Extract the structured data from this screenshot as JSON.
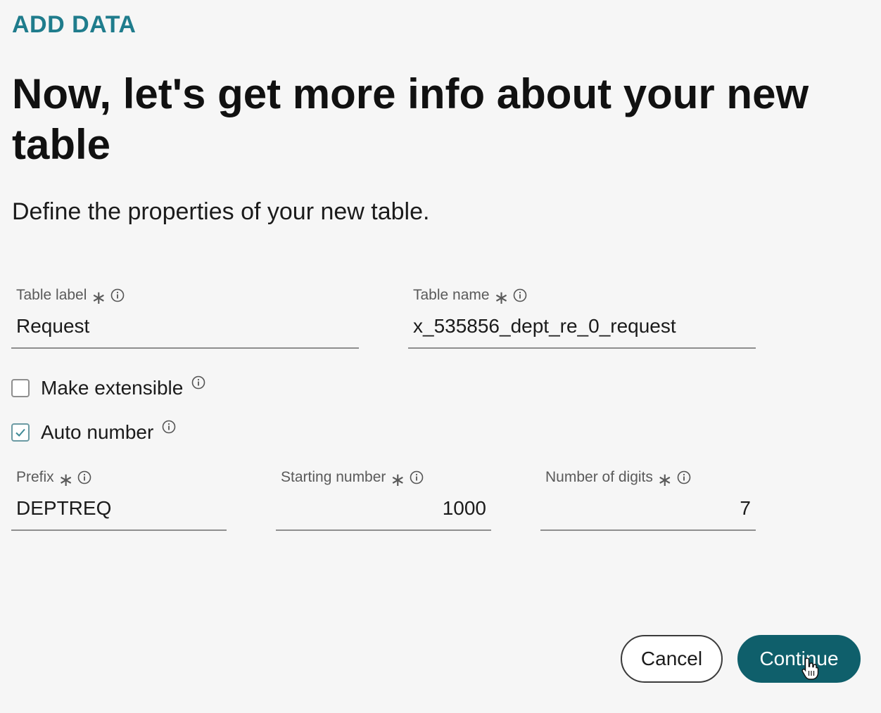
{
  "header": {
    "eyebrow": "ADD DATA",
    "title": "Now, let's get more info about your new table",
    "subtitle": "Define the properties of your new table."
  },
  "form": {
    "table_label": {
      "label": "Table label",
      "required_mark": "∗",
      "value": "Request"
    },
    "table_name": {
      "label": "Table name",
      "required_mark": "∗",
      "value": "x_535856_dept_re_0_request"
    },
    "make_extensible": {
      "label": "Make extensible",
      "checked": false
    },
    "auto_number": {
      "label": "Auto number",
      "checked": true
    },
    "prefix": {
      "label": "Prefix",
      "required_mark": "∗",
      "value": "DEPTREQ"
    },
    "starting_number": {
      "label": "Starting number",
      "required_mark": "∗",
      "value": "1000"
    },
    "number_of_digits": {
      "label": "Number of digits",
      "required_mark": "∗",
      "value": "7"
    }
  },
  "actions": {
    "cancel_label": "Cancel",
    "continue_label": "Continue"
  },
  "icons": {
    "info": "info-icon",
    "check": "check-icon",
    "cursor": "hand-cursor-icon"
  },
  "colors": {
    "accent": "#1f7c8c",
    "primary_button": "#0f5f6b",
    "background": "#f6f6f6"
  }
}
